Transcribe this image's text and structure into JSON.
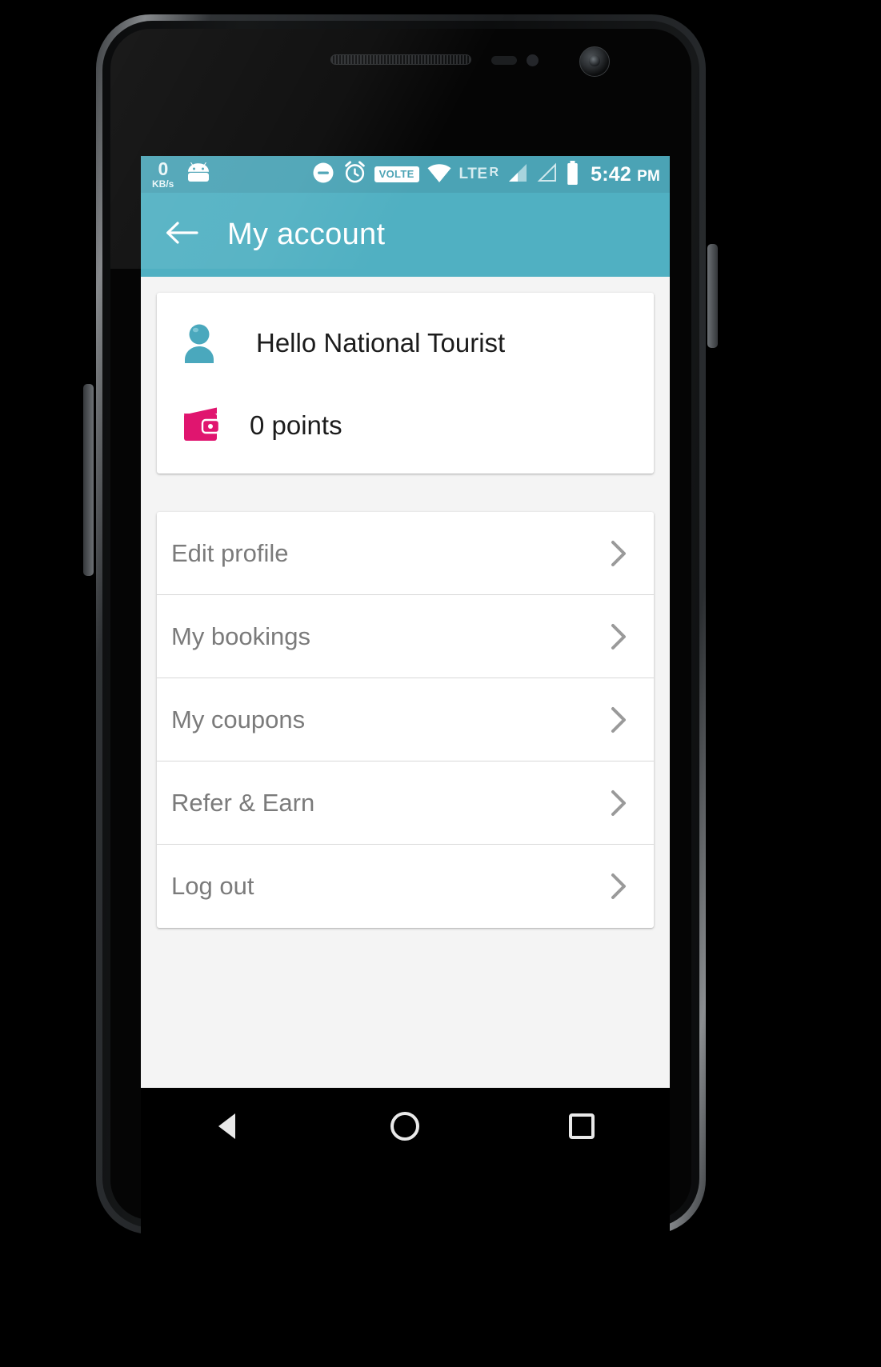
{
  "statusbar": {
    "network_speed_value": "0",
    "network_speed_unit": "KB/s",
    "icons": [
      "android-robot-icon",
      "do-not-disturb-icon",
      "alarm-clock-icon"
    ],
    "volte_label": "VOLTE",
    "network_type": "LTE",
    "roaming": "R",
    "time": "5:42",
    "time_suffix": "PM",
    "bar_color": "#4ba3b5"
  },
  "appbar": {
    "title": "My account",
    "back_icon": "arrow-left-icon",
    "color": "#50b0c2"
  },
  "profile": {
    "avatar_icon": "person-icon",
    "greeting": "Hello National Tourist",
    "wallet_icon": "wallet-icon",
    "points": "0 points",
    "avatar_color": "#4aa8bd",
    "wallet_color": "#e0156f"
  },
  "menu": {
    "items": [
      {
        "label": "Edit profile",
        "chevron": "chevron-right-icon"
      },
      {
        "label": "My bookings",
        "chevron": "chevron-right-icon"
      },
      {
        "label": "My coupons",
        "chevron": "chevron-right-icon"
      },
      {
        "label": "Refer & Earn",
        "chevron": "chevron-right-icon"
      },
      {
        "label": "Log out",
        "chevron": "chevron-right-icon"
      }
    ]
  },
  "navbar": {
    "back": "back-triangle-icon",
    "home": "home-circle-icon",
    "recents": "recents-square-icon"
  }
}
